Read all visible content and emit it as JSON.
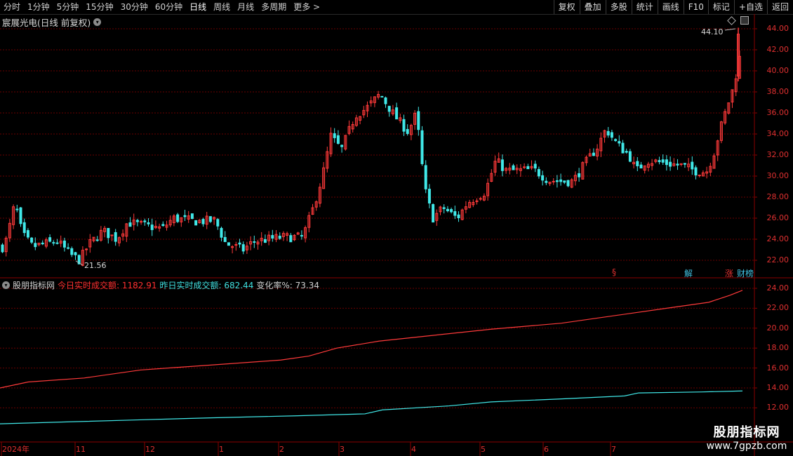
{
  "toolbar": {
    "left_items": [
      "分时",
      "1分钟",
      "5分钟",
      "15分钟",
      "30分钟",
      "60分钟",
      "日线",
      "周线",
      "月线",
      "多周期",
      "更多 >"
    ],
    "active": "日线",
    "right_items": [
      "复权",
      "叠加",
      "多股",
      "统计",
      "画线",
      "F10",
      "标记",
      "+自选",
      "返回"
    ]
  },
  "main_chart": {
    "title": "宸展光电(日线 前复权)",
    "y_axis": [
      "44.00",
      "42.00",
      "40.00",
      "38.00",
      "36.00",
      "34.00",
      "32.00",
      "30.00",
      "28.00",
      "26.00",
      "24.00",
      "22.00"
    ],
    "high_label": "44.10",
    "low_label": "21.56",
    "badges": [
      {
        "text": "§",
        "color": "#e03030"
      },
      {
        "text": "解",
        "color": "#40c0e0"
      },
      {
        "text": "涨",
        "color": "#e03030"
      },
      {
        "text": "财榜",
        "color": "#40c0e0"
      }
    ]
  },
  "indicator": {
    "name": "股朋指标网",
    "today_label": "今日实时成交额: 1182.91",
    "yesterday_label": "昨日实时成交额: 682.44",
    "change_label": "变化率%: 73.34",
    "y_axis": [
      "24.00",
      "22.00",
      "20.00",
      "18.00",
      "16.00",
      "14.00",
      "12.00"
    ]
  },
  "date_axis": [
    "2024年",
    "11",
    "12",
    "1",
    "2",
    "3",
    "4",
    "5",
    "6",
    "7"
  ],
  "watermark": {
    "line1": "股朋指标网",
    "line2": "www.7gpzb.com"
  },
  "colors": {
    "up": "#ff3a3a",
    "down": "#40e8e8",
    "grid": "#6a0000",
    "bg": "#000000"
  }
}
